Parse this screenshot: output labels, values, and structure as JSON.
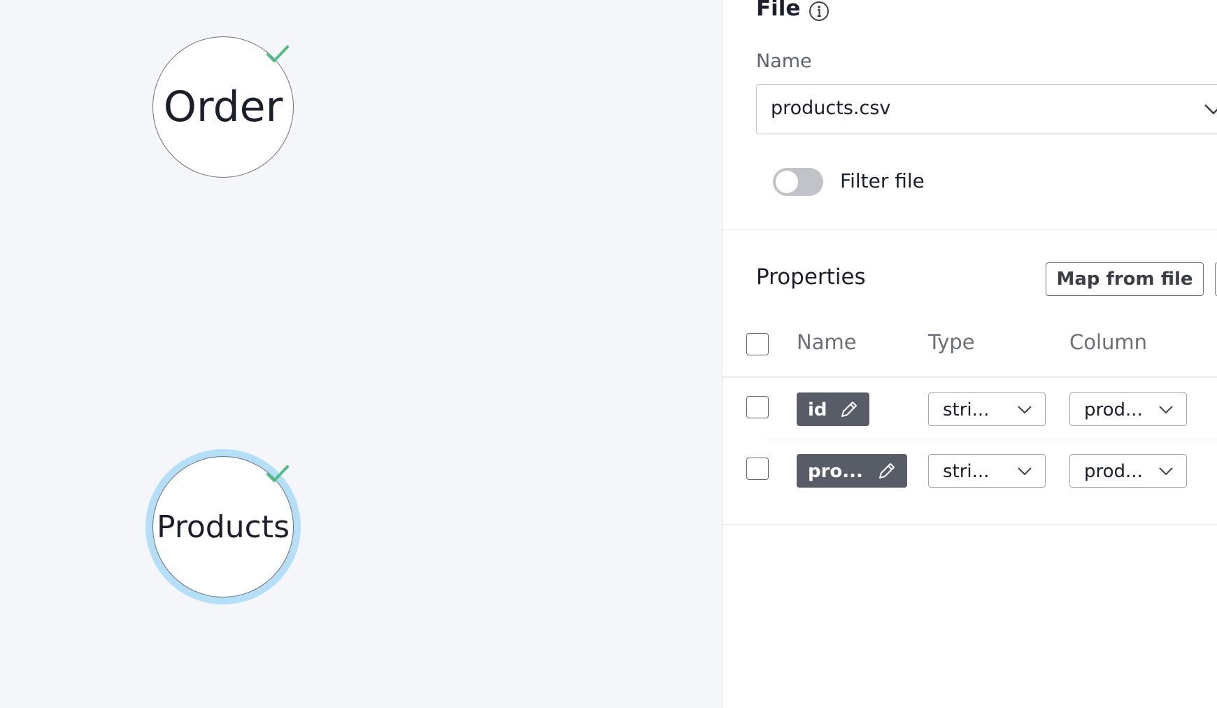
{
  "canvas": {
    "nodes": [
      {
        "label": "Order",
        "valid": true,
        "selected": false
      },
      {
        "label": "Products",
        "valid": true,
        "selected": true
      }
    ]
  },
  "panel": {
    "file": {
      "title": "File",
      "name_label": "Name",
      "selected_file": "products.csv",
      "filter_label": "Filter file",
      "filter_enabled": false
    },
    "properties": {
      "title": "Properties",
      "map_button": "Map from file",
      "columns": [
        "Name",
        "Type",
        "Column"
      ],
      "rows": [
        {
          "name": "id",
          "type": "stri...",
          "column": "prod..."
        },
        {
          "name": "pro...",
          "type": "stri...",
          "column": "prod..."
        }
      ]
    }
  },
  "colors": {
    "check": "#4cbf83",
    "selection_ring": "#b3dff8",
    "chip": "#575c67"
  }
}
